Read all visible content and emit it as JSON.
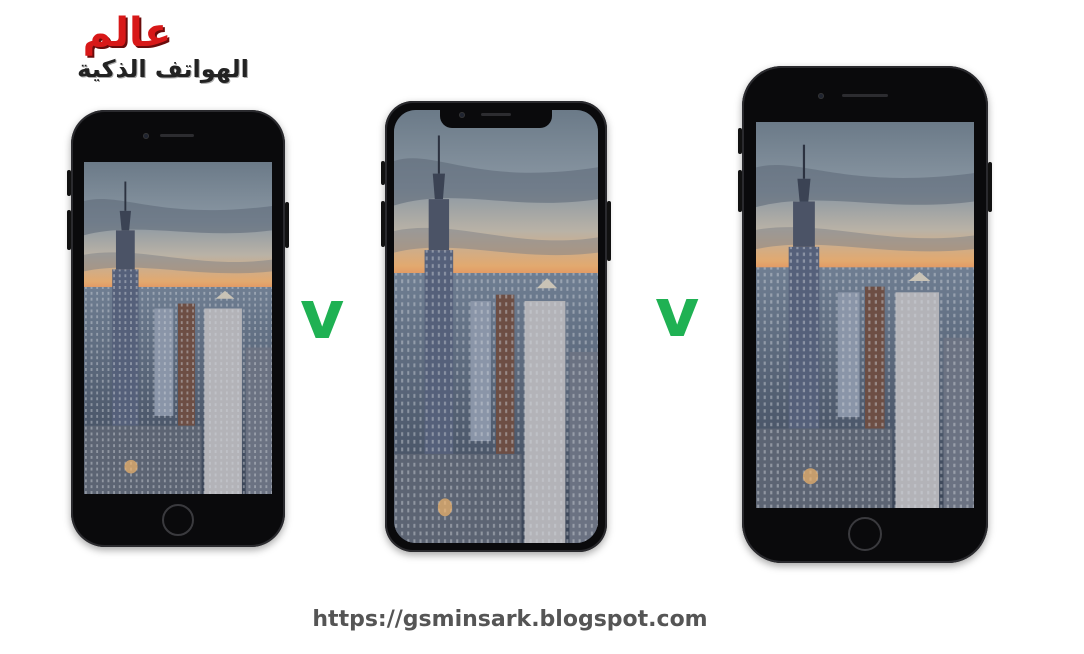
{
  "logo": {
    "main_text": "عالم",
    "sub_text": "الهواتف الذكية"
  },
  "comparison": {
    "separator_1": "v",
    "separator_2": "v"
  },
  "phones": [
    {
      "label": "small phone",
      "icon": "phone-with-home-button"
    },
    {
      "label": "notch phone",
      "icon": "phone-full-screen-notch"
    },
    {
      "label": "large phone",
      "icon": "phone-with-home-button"
    }
  ],
  "footer": {
    "url": "https://gsminsark.blogspot.com"
  },
  "colors": {
    "logo_red": "#d81818",
    "check_green": "#1fb153",
    "url_gray": "#555555",
    "phone_body": "#0a0a0c"
  }
}
